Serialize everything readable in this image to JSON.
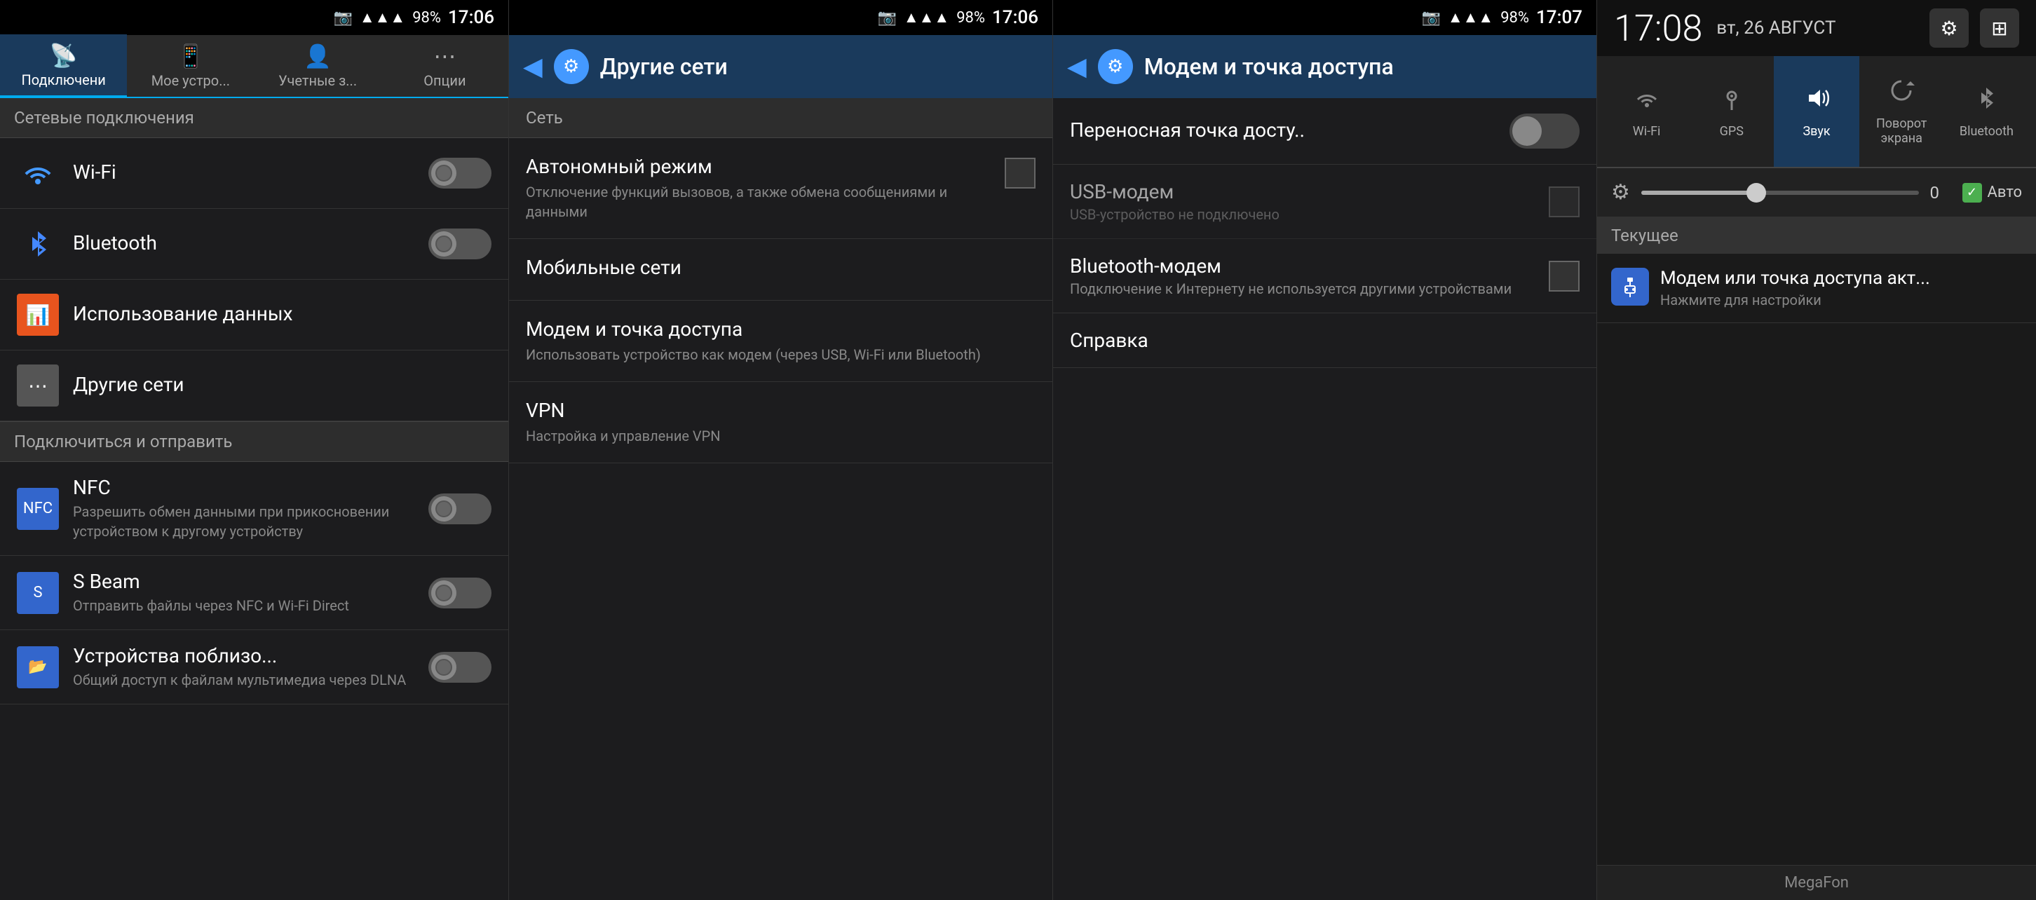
{
  "panel1": {
    "statusBar": {
      "signal": "▲▲▲",
      "battery": "98%",
      "time": "17:06",
      "cameraIcon": "📷"
    },
    "tabs": [
      {
        "id": "connections",
        "label": "Подключени",
        "icon": "📡",
        "active": true
      },
      {
        "id": "myDevice",
        "label": "Мое устро...",
        "icon": "📱",
        "active": false
      },
      {
        "id": "accounts",
        "label": "Учетные з...",
        "icon": "👤",
        "active": false
      },
      {
        "id": "options",
        "label": "Опции",
        "icon": "⋯",
        "active": false
      }
    ],
    "networkSection": "Сетевые подключения",
    "items": [
      {
        "id": "wifi",
        "icon": "wifi",
        "title": "Wi-Fi",
        "toggle": true,
        "toggleOn": false
      },
      {
        "id": "bluetooth",
        "icon": "bt",
        "title": "Bluetooth",
        "toggle": true,
        "toggleOn": false
      }
    ],
    "dataItem": {
      "icon": "data",
      "title": "Использование данных"
    },
    "otherItem": {
      "icon": "other",
      "title": "Другие сети"
    },
    "connectSection": "Подключиться и отправить",
    "connectItems": [
      {
        "id": "nfc",
        "icon": "nfc",
        "title": "NFC",
        "subtitle": "Разрешить обмен данными при прикосновении устройством к другому устройству",
        "toggle": true
      },
      {
        "id": "sbeam",
        "icon": "sbeam",
        "title": "S Beam",
        "subtitle": "Отправить файлы через NFC и Wi-Fi Direct",
        "toggle": true
      },
      {
        "id": "nearby",
        "icon": "nearby",
        "title": "Устройства поблизо...",
        "subtitle": "Общий доступ к файлам мультимедиа через DLNA",
        "toggle": true
      }
    ]
  },
  "panel2": {
    "statusBar": {
      "signal": "▲▲▲",
      "battery": "98%",
      "time": "17:06",
      "cameraIcon": "📷"
    },
    "backLabel": "◀",
    "title": "Другие сети",
    "networkSectionLabel": "Сеть",
    "menuItems": [
      {
        "id": "airplane",
        "title": "Автономный режим",
        "subtitle": "Отключение функций вызовов, а также обмена сообщениями и данными",
        "hasCheckbox": true
      },
      {
        "id": "mobilenet",
        "title": "Мобильные сети",
        "subtitle": "",
        "hasCheckbox": false
      },
      {
        "id": "tethering",
        "title": "Модем и точка доступа",
        "subtitle": "Использовать устройство как модем (через USB, Wi-Fi или Bluetooth)",
        "hasCheckbox": false
      },
      {
        "id": "vpn",
        "title": "VPN",
        "subtitle": "Настройка и управление VPN",
        "hasCheckbox": false
      }
    ]
  },
  "panel3": {
    "statusBar": {
      "signal": "▲▲▲",
      "battery": "98%",
      "time": "17:07",
      "cameraIcon": "📷"
    },
    "backLabel": "◀",
    "title": "Модем и точка доступа",
    "items": [
      {
        "id": "hotspot",
        "title": "Переносная точка досту..",
        "subtitle": "",
        "hasToggle": true
      },
      {
        "id": "usb-modem",
        "title": "USB-модем",
        "subtitle": "USB-устройство не подключено",
        "hasCheckbox": true,
        "disabled": true
      },
      {
        "id": "bt-modem",
        "title": "Bluetooth-модем",
        "subtitle": "Подключение к Интернету не используется другими устройствами",
        "hasCheckbox": true
      }
    ],
    "helpLabel": "Справка"
  },
  "panel4": {
    "time": "17:08",
    "date": "вт, 26 АВГУСТ",
    "icons": {
      "settings": "⚙",
      "grid": "⊞"
    },
    "quickToggles": [
      {
        "id": "wifi",
        "icon": "wifi",
        "label": "Wi-Fi",
        "active": false
      },
      {
        "id": "gps",
        "icon": "gps",
        "label": "GPS",
        "active": false
      },
      {
        "id": "sound",
        "icon": "sound",
        "label": "Звук",
        "active": true
      },
      {
        "id": "rotate",
        "icon": "rotate",
        "label": "Поворот экрана",
        "active": false
      },
      {
        "id": "bluetooth",
        "icon": "bt",
        "label": "Bluetooth",
        "active": false
      }
    ],
    "brightness": {
      "value": "0",
      "autoLabel": "Авто",
      "fillPercent": 38
    },
    "currentLabel": "Текущее",
    "notification": {
      "icon": "usb",
      "title": "Модем или точка доступа акт...",
      "subtitle": "Нажмите для настройки"
    },
    "carrier": "MegaFon"
  }
}
